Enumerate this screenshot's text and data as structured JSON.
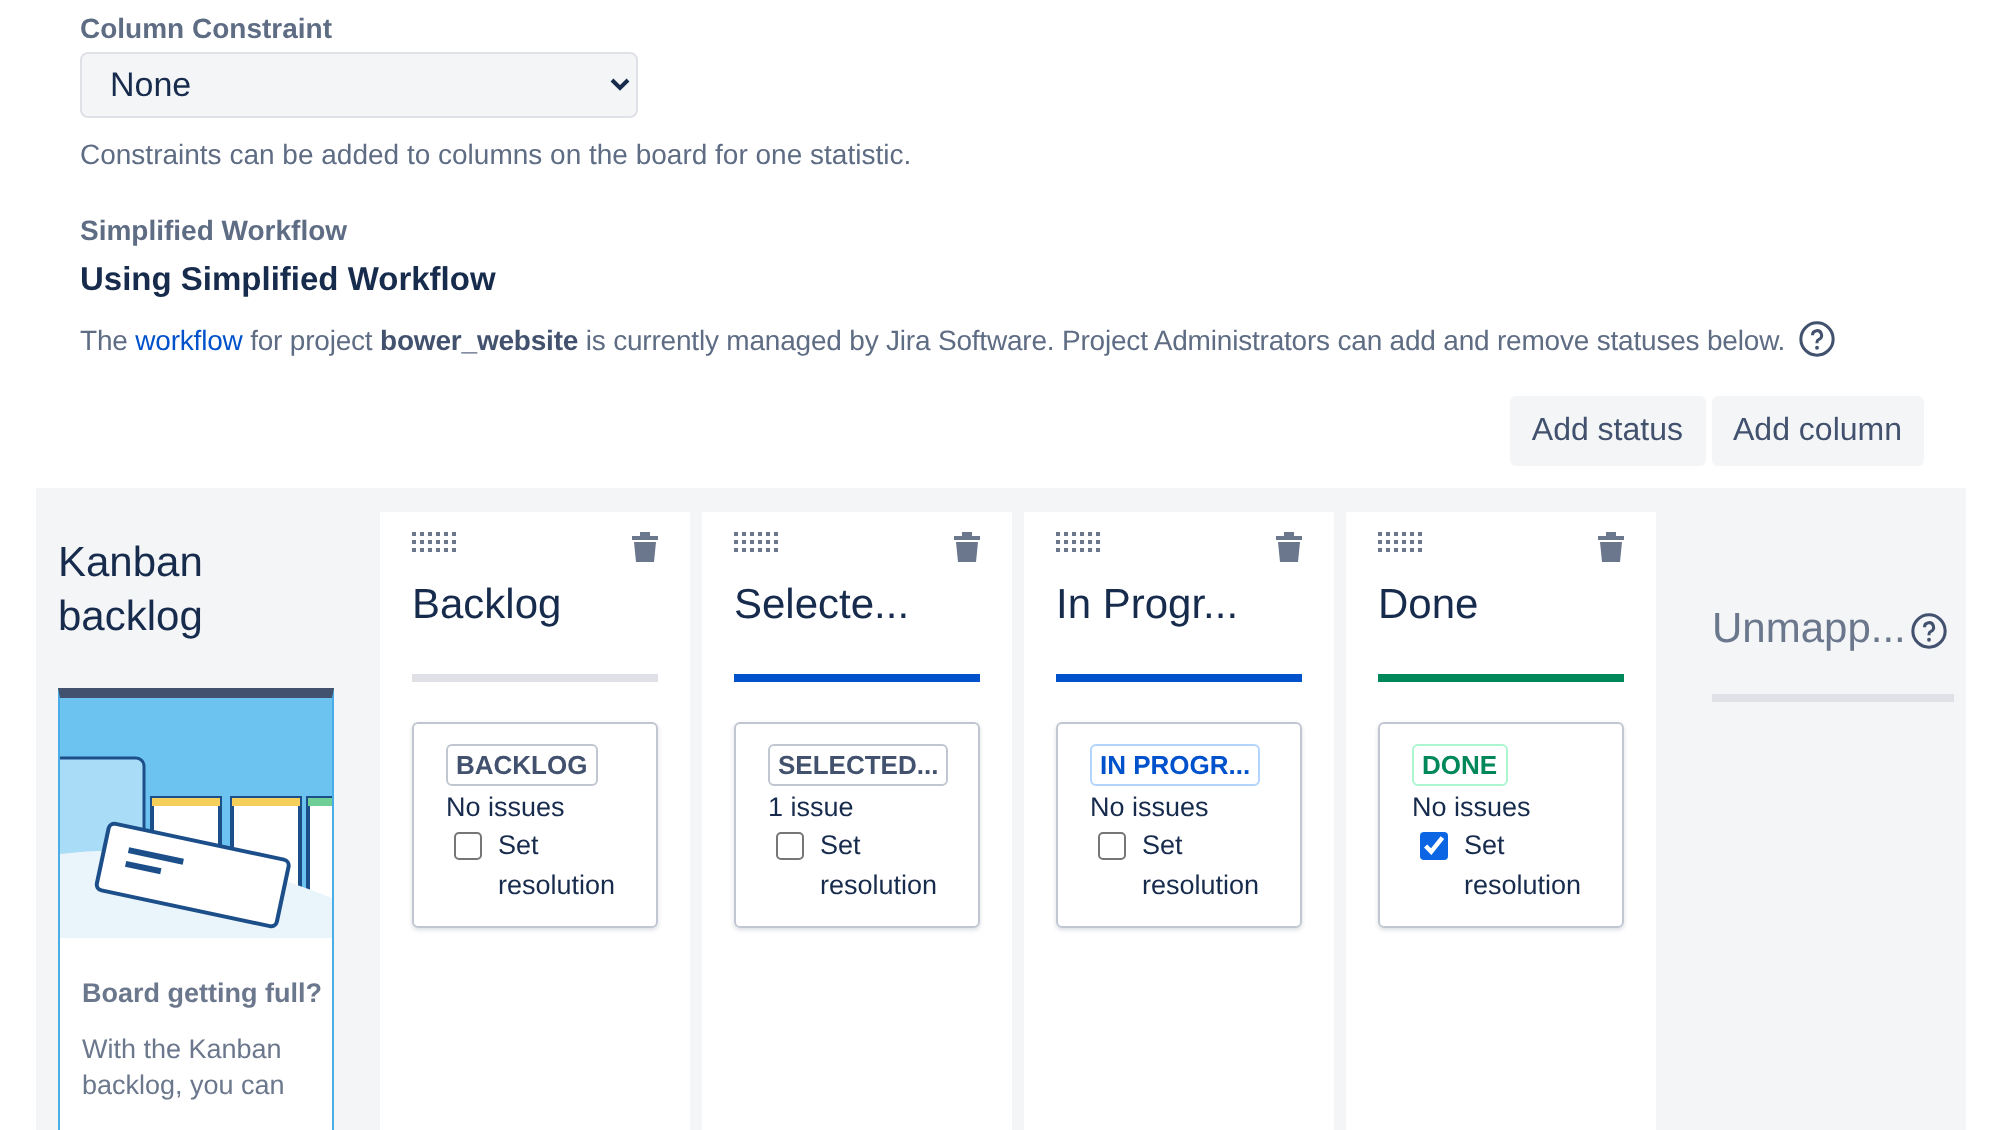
{
  "column_constraint": {
    "label": "Column Constraint",
    "value": "None",
    "help": "Constraints can be added to columns on the board for one statistic."
  },
  "workflow": {
    "label": "Simplified Workflow",
    "heading": "Using Simplified Workflow",
    "description_start": "The",
    "link": "workflow",
    "description_end": "for project **bower_website** is currently managed by Jira Software. Project Administrators can add and remove statuses below."
  },
  "actions": [
    "Add status",
    "Add column"
  ],
  "kanban_backlog": {
    "title": "Kanban backlog",
    "card_title": "Board getting full?",
    "card_text": "With the Kanban backlog, you can"
  },
  "columns": [
    {
      "title": "Backlog",
      "color": "#dfe1e6",
      "status": {
        "label": "BACKLOG",
        "kind": "default"
      },
      "issues": "No issues",
      "resolution_label": "Set resolution",
      "resolution_checked": false
    },
    {
      "title": "Selecte...",
      "color": "#0052cc",
      "status": {
        "label": "SELECTED...",
        "kind": "default"
      },
      "issues": "1 issue",
      "resolution_label": "Set resolution",
      "resolution_checked": false
    },
    {
      "title": "In Progr...",
      "color": "#0052cc",
      "status": {
        "label": "IN PROGR...",
        "kind": "inprogress"
      },
      "issues": "No issues",
      "resolution_label": "Set resolution",
      "resolution_checked": false
    },
    {
      "title": "Done",
      "color": "#00875a",
      "status": {
        "label": "DONE",
        "kind": "success"
      },
      "issues": "No issues",
      "resolution_label": "Set resolution",
      "resolution_checked": true
    }
  ],
  "unmapped": {
    "title": "Unmapp..."
  }
}
